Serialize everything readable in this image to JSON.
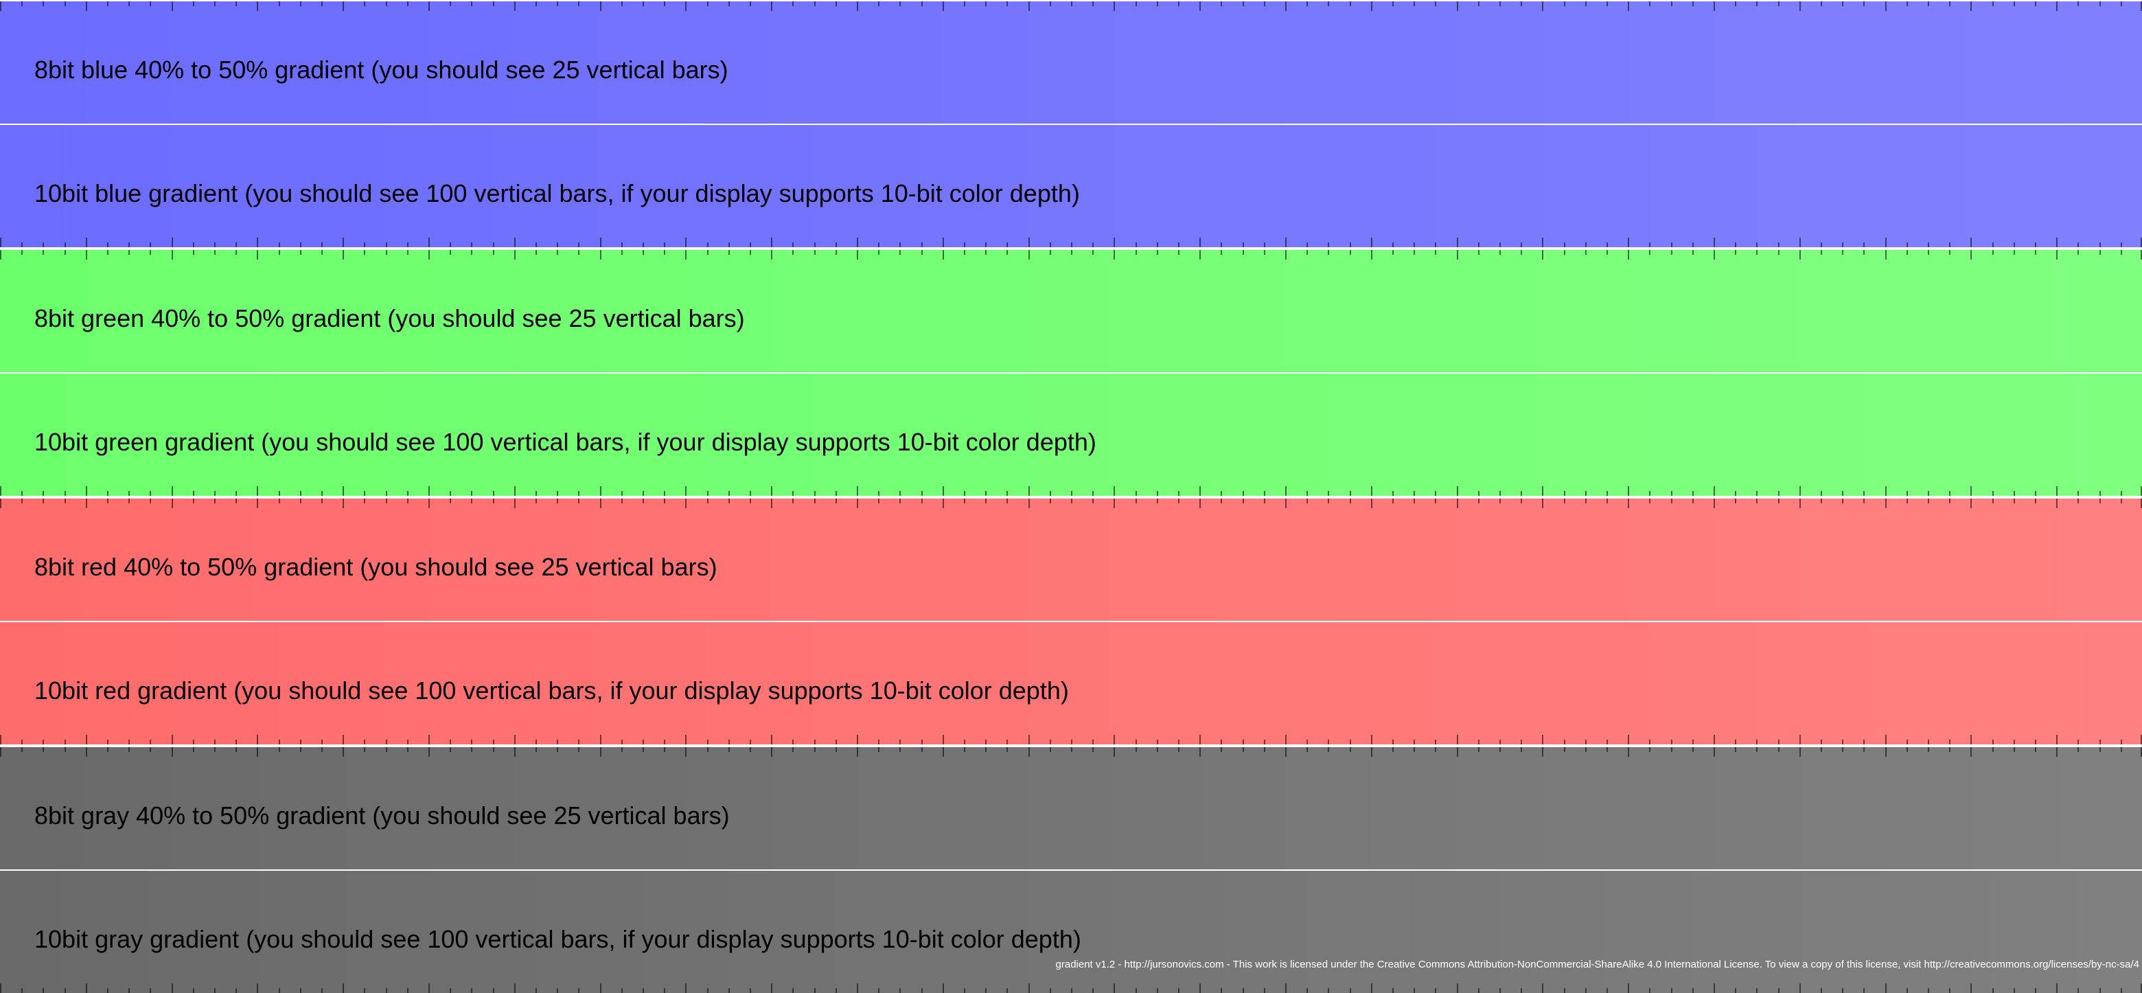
{
  "panels": [
    {
      "name": "blue",
      "color_start": "#6c6cff",
      "color_end": "#8080ff",
      "rows": [
        {
          "label": "8bit blue 40% to 50% gradient (you should see 25 vertical bars)",
          "bars": 25
        },
        {
          "label": "10bit blue gradient (you should see 100 vertical bars, if your display supports 10-bit color depth)",
          "bars": 100
        }
      ]
    },
    {
      "name": "green",
      "color_start": "#6cff6c",
      "color_end": "#80ff80",
      "rows": [
        {
          "label": "8bit green 40% to 50% gradient (you should see 25 vertical bars)",
          "bars": 25
        },
        {
          "label": "10bit green gradient (you should see 100 vertical bars, if your display supports 10-bit color depth)",
          "bars": 100
        }
      ]
    },
    {
      "name": "red",
      "color_start": "#ff6c6c",
      "color_end": "#ff8080",
      "rows": [
        {
          "label": "8bit red 40% to 50% gradient (you should see 25 vertical bars)",
          "bars": 25
        },
        {
          "label": "10bit red gradient (you should see 100 vertical bars, if your display supports 10-bit color depth)",
          "bars": 100
        }
      ]
    },
    {
      "name": "gray",
      "color_start": "#6a6a6a",
      "color_end": "#808080",
      "rows": [
        {
          "label": "8bit gray 40% to 50% gradient (you should see 25 vertical bars)",
          "bars": 25
        },
        {
          "label": "10bit gray gradient (you should see 100 vertical bars, if your display supports 10-bit color depth)",
          "bars": 100
        }
      ]
    }
  ],
  "footer": {
    "text": "gradient v1.2 - http://jursonovics.com - This work is licensed under the Creative Commons Attribution-NonCommercial-ShareAlike 4.0 International License. To view a copy of this license, visit http://creativecommons.org/licenses/by-nc-sa/4"
  }
}
